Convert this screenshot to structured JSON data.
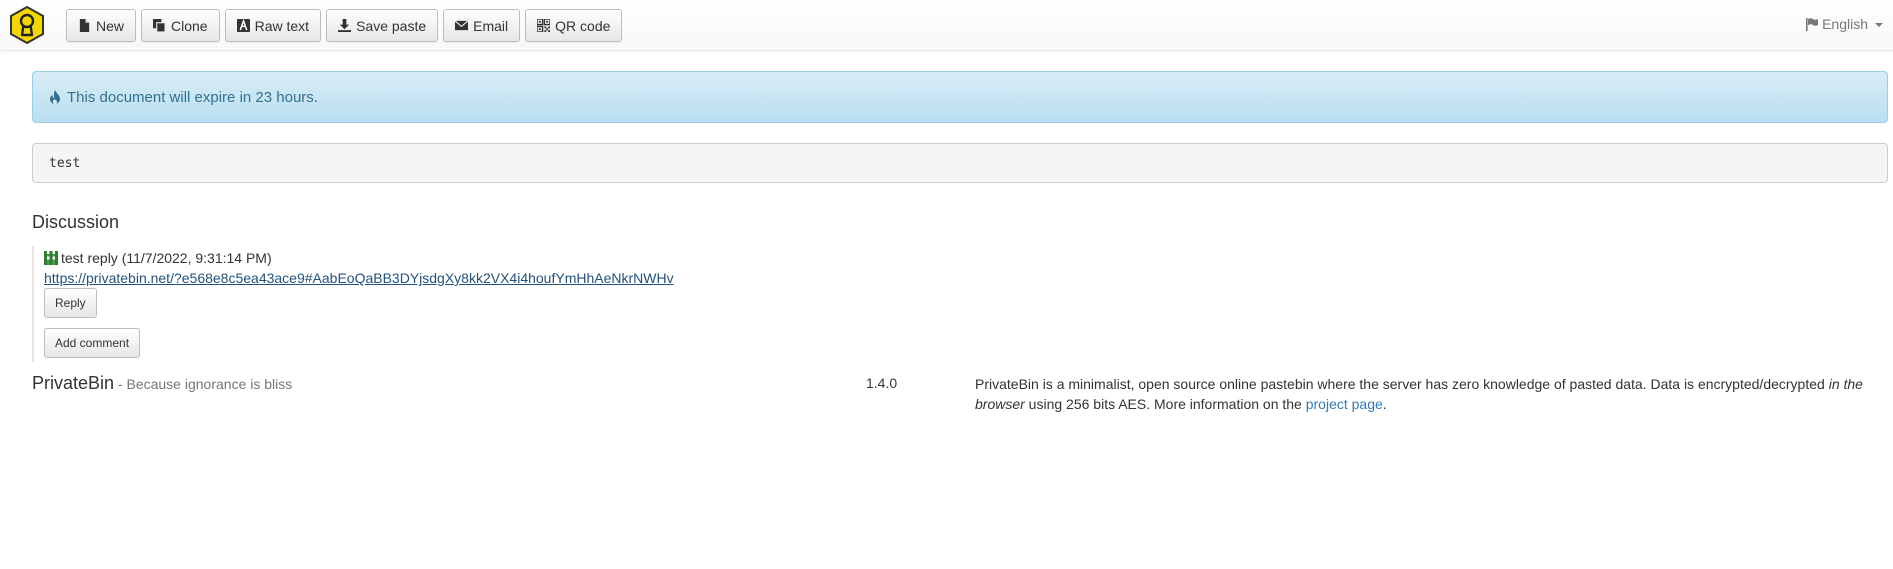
{
  "navbar": {
    "logo_icon": "keyhole-shield-icon",
    "buttons": [
      {
        "label": "New",
        "icon": "file-icon"
      },
      {
        "label": "Clone",
        "icon": "duplicate-icon"
      },
      {
        "label": "Raw text",
        "icon": "text-background-icon"
      },
      {
        "label": "Save paste",
        "icon": "download-icon"
      },
      {
        "label": "Email",
        "icon": "envelope-icon"
      },
      {
        "label": "QR code",
        "icon": "qrcode-icon"
      }
    ],
    "language": "English",
    "language_icon": "flag-icon"
  },
  "alert": {
    "icon": "fire-icon",
    "text": "This document will expire in 23 hours."
  },
  "paste": {
    "content": "test"
  },
  "discussion": {
    "title": "Discussion",
    "comments": [
      {
        "avatar_icon": "identicon-avatar",
        "meta": "test reply (11/7/2022, 9:31:14 PM)",
        "link": "https://privatebin.net/?e568e8c5ea43ace9#AabEoQaBB3DYjsdgXy8kk2VX4i4houfYmHhAeNkrNWHv",
        "reply_label": "Reply"
      }
    ],
    "add_comment_label": "Add comment"
  },
  "footer": {
    "brand_name": "PrivateBin",
    "tagline": " - Because ignorance is bliss",
    "version": "1.4.0",
    "about_before": "PrivateBin is a minimalist, open source online pastebin where the server has zero knowledge of pasted data. Data is encrypted/decrypted ",
    "about_em": "in the browser",
    "about_middle": " using 256 bits AES. More information on the ",
    "about_link": "project page",
    "about_after": "."
  },
  "colors": {
    "alert_text": "#31708f",
    "alert_bg": "#d9edf7",
    "link": "#337ab7",
    "logo_yellow": "#f5d800"
  }
}
